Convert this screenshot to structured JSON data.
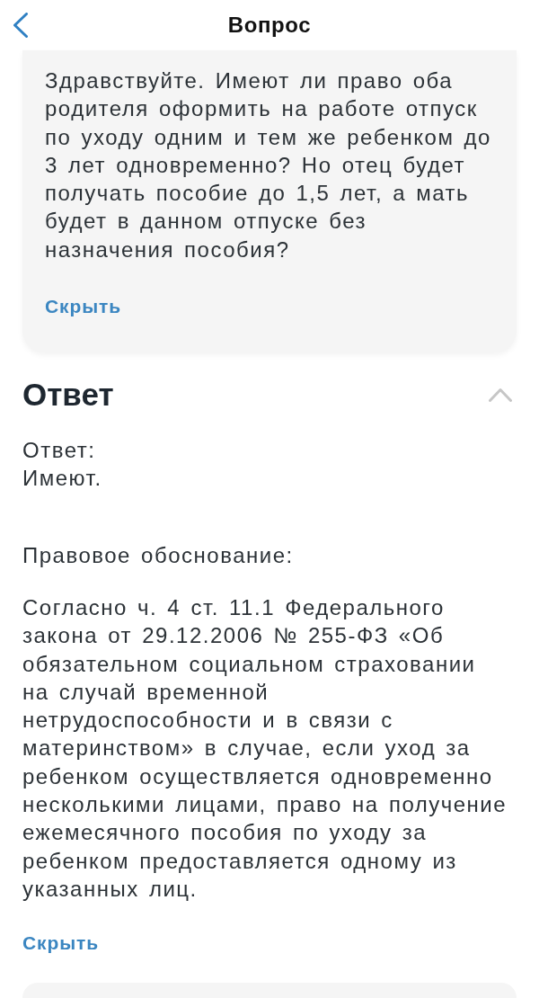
{
  "header": {
    "title": "Вопрос"
  },
  "question": {
    "text": "Здравствуйте. Имеют ли право оба\nродителя оформить на работе отпуск\nпо уходу одним и тем же ребенком до\n3 лет одновременно? Но отец будет\nполучать пособие до 1,5 лет, а мать\nбудет в данном отпуске без\nназначения пособия?",
    "toggle": "Скрыть"
  },
  "answer": {
    "title": "Ответ",
    "expanded": true,
    "short_label": "Ответ:",
    "short_text": "Имеют.",
    "basis_label": "Правовое обоснование:",
    "basis_text": "Согласно ч. 4 ст. 11.1 Федерального\nзакона от 29.12.2006 № 255-ФЗ «Об\nобязательном социальном страховании\nна случай временной\nнетрудоспособности и в связи с\nматеринством» в случае, если уход за\nребенком осуществляется одновременно\nнесколькими лицами, право на получение\nежемесячного пособия по уходу за\nребенком предоставляется одному из\nуказанных лиц.",
    "toggle": "Скрыть"
  }
}
